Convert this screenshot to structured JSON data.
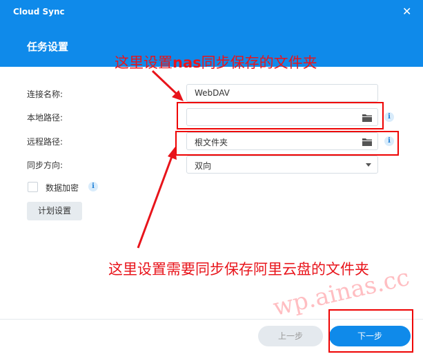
{
  "window": {
    "app_title": "Cloud Sync",
    "close_symbol": "✕"
  },
  "dialog": {
    "title": "任务设置"
  },
  "form": {
    "connection_name": {
      "label": "连接名称:",
      "value": "WebDAV"
    },
    "local_path": {
      "label": "本地路径:",
      "value": "",
      "icon": "folder-icon"
    },
    "remote_path": {
      "label": "远程路径:",
      "value": "根文件夹",
      "icon": "folder-icon"
    },
    "sync_direction": {
      "label": "同步方向:",
      "value": "双向"
    },
    "encryption": {
      "label": "数据加密",
      "checked": false
    },
    "info_icon_glyph": "i",
    "schedule_button": "计划设置"
  },
  "footer": {
    "prev_button": "上一步",
    "next_button": "下一步"
  },
  "annotations": {
    "top_note_prefix": "这里设置",
    "top_note_bold": "nas",
    "top_note_suffix": "同步保存的文件夹",
    "bottom_note": "这里设置需要同步保存阿里云盘的文件夹",
    "watermark": "wp.ainas.cc"
  },
  "colors": {
    "header_blue": "#0f8aea",
    "annotation_red": "#e8141b"
  }
}
